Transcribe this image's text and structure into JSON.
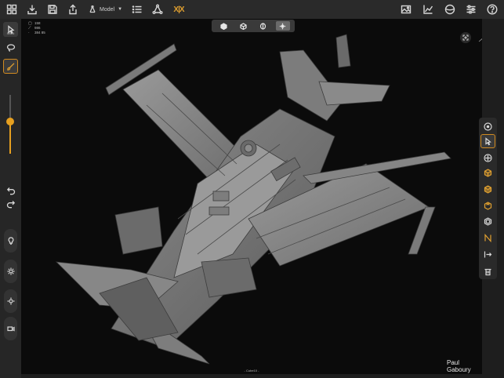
{
  "toolbar": {
    "mode_label": "Model"
  },
  "left_toolbar": {
    "select_caption": "Select"
  },
  "viewport": {
    "stats": {
      "vertices": "158",
      "edges": "986",
      "faces": "384 85"
    },
    "object_label": "- Cube10 -",
    "author": "Paul Gaboury"
  },
  "colors": {
    "accent": "#e0a030",
    "background": "#0b0b0b",
    "panel": "#2a2a2a"
  }
}
